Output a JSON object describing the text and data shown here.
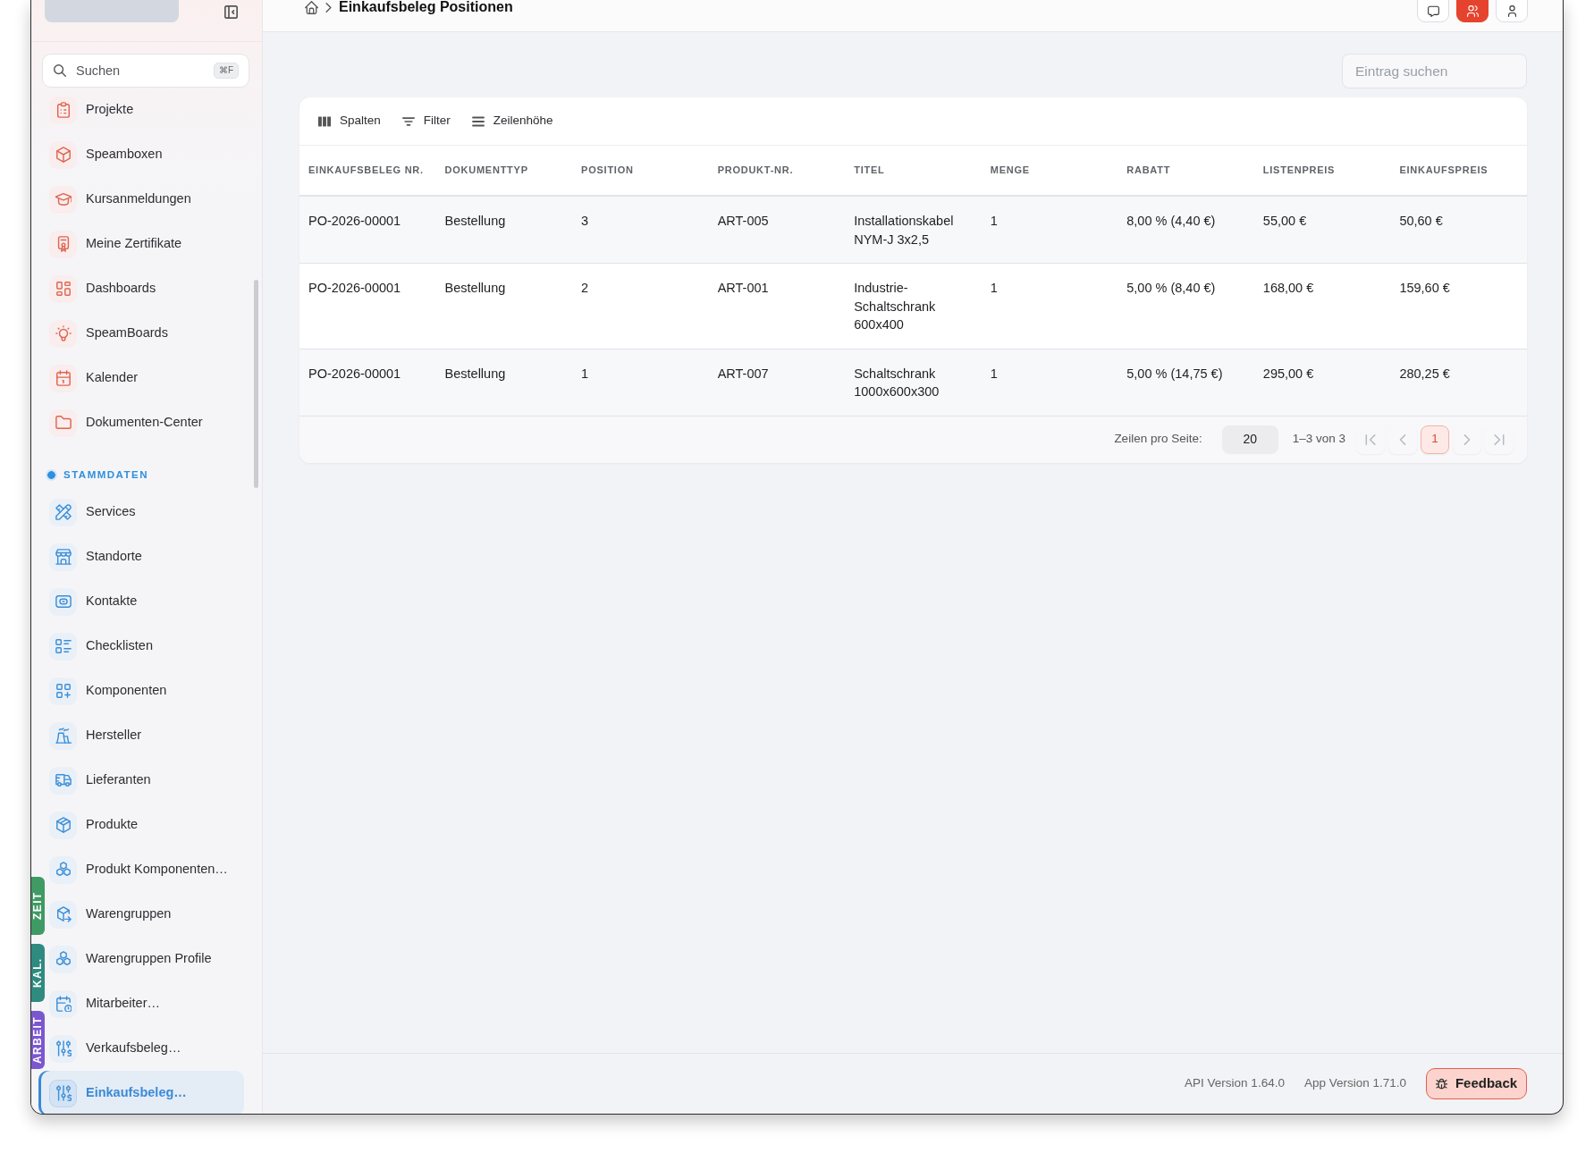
{
  "side_tabs": [
    {
      "label": "ZEIT",
      "color": "#3f9a63"
    },
    {
      "label": "KAL.",
      "color": "#2f8a80"
    },
    {
      "label": "ARBEIT",
      "color": "#7b57cf"
    }
  ],
  "sidebar": {
    "search": {
      "placeholder": "Suchen",
      "shortcut": "⌘F"
    },
    "groups": [
      {
        "items": [
          {
            "label": "Projekte",
            "selected": false
          },
          {
            "label": "Speamboxen",
            "selected": false
          },
          {
            "label": "Kursanmeldungen",
            "selected": false
          },
          {
            "label": "Meine Zertifikate",
            "selected": false
          },
          {
            "label": "Dashboards",
            "selected": false
          },
          {
            "label": "SpeamBoards",
            "selected": false
          },
          {
            "label": "Kalender",
            "selected": false
          },
          {
            "label": "Dokumenten-Center",
            "selected": false
          }
        ]
      },
      {
        "title": "STAMMDATEN",
        "items": [
          {
            "label": "Services",
            "selected": false
          },
          {
            "label": "Standorte",
            "selected": false
          },
          {
            "label": "Kontakte",
            "selected": false
          },
          {
            "label": "Checklisten",
            "selected": false
          },
          {
            "label": "Komponenten",
            "selected": false
          },
          {
            "label": "Hersteller",
            "selected": false
          },
          {
            "label": "Lieferanten",
            "selected": false
          },
          {
            "label": "Produkte",
            "selected": false
          },
          {
            "label": "Produkt Komponenten…",
            "selected": false
          },
          {
            "label": "Warengruppen",
            "selected": false
          },
          {
            "label": "Warengruppen Profile",
            "selected": false
          },
          {
            "label": "Mitarbeiter…",
            "selected": false
          },
          {
            "label": "Verkaufsbeleg…",
            "selected": false
          },
          {
            "label": "Einkaufsbeleg…",
            "selected": true
          }
        ]
      }
    ]
  },
  "header": {
    "title": "Einkaufsbeleg Positionen",
    "buttons": [
      {
        "active": false
      },
      {
        "active": true
      },
      {
        "active": false
      }
    ]
  },
  "search": {
    "placeholder": "Eintrag suchen"
  },
  "table": {
    "toolbar": [
      "Spalten",
      "Filter",
      "Zeilenhöhe"
    ],
    "columns": [
      "EINKAUFSBELEG NR.",
      "DOKUMENTTYP",
      "POSITION",
      "PRODUKT-NR.",
      "TITEL",
      "MENGE",
      "RABATT",
      "LISTENPREIS",
      "EINKAUFSPREIS"
    ],
    "rows": [
      [
        "PO-2026-00001",
        "Bestellung",
        "3",
        "ART-005",
        "Installationskabel NYM-J 3x2,5",
        "1",
        "8,00 % (4,40 €)",
        "55,00 €",
        "50,60 €"
      ],
      [
        "PO-2026-00001",
        "Bestellung",
        "2",
        "ART-001",
        "Industrie-Schaltschrank 600x400",
        "1",
        "5,00 % (8,40 €)",
        "168,00 €",
        "159,60 €"
      ],
      [
        "PO-2026-00001",
        "Bestellung",
        "1",
        "ART-007",
        "Schaltschrank 1000x600x300",
        "1",
        "5,00 % (14,75 €)",
        "295,00 €",
        "280,25 €"
      ]
    ],
    "pagination": {
      "rows_label": "Zeilen pro Seite:",
      "rows_per_page": "20",
      "range": "1–3 von 3",
      "nav_before": [
        {
          "kind": "first",
          "disabled": true
        },
        {
          "kind": "prev",
          "disabled": true
        }
      ],
      "pages": [
        {
          "label": "1",
          "selected": true
        }
      ],
      "nav_after": [
        {
          "kind": "next",
          "disabled": true
        },
        {
          "kind": "last",
          "disabled": true
        }
      ]
    }
  },
  "footer": {
    "api_version": "API Version 1.64.0",
    "app_version": "App Version 1.71.0",
    "feedback": "Feedback"
  }
}
